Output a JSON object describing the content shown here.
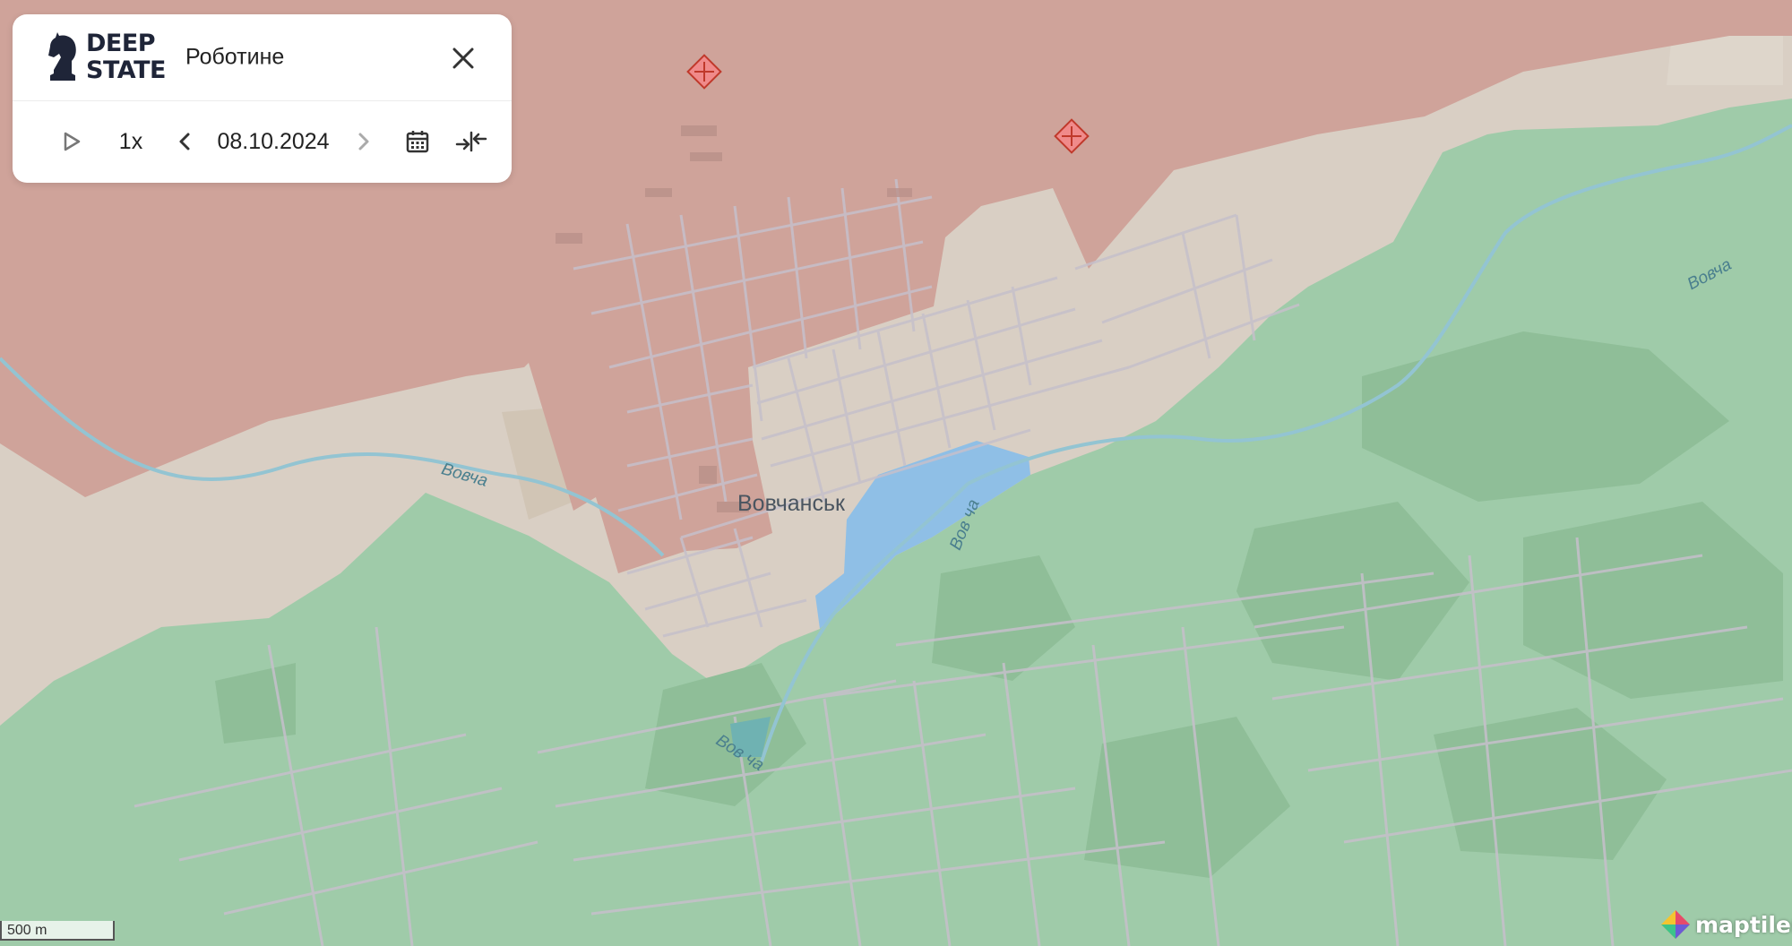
{
  "header": {
    "logo_line1": "DEEP",
    "logo_line2": "STATE",
    "region_name": "Роботине"
  },
  "controls": {
    "speed": "1x",
    "date": "08.10.2024"
  },
  "icons": {
    "logo": "knight-chess-icon",
    "close": "close-icon",
    "play": "play-icon",
    "prev": "chevron-left-icon",
    "next": "chevron-right-icon",
    "calendar": "calendar-icon",
    "collapse": "collapse-arrows-icon",
    "marker": "red-diamond-marker-icon"
  },
  "map": {
    "city_label": "Вовчанськ",
    "river_labels": [
      "Вовча",
      "Вов ча",
      "Вов ча",
      "Вовча"
    ],
    "zone_colors": {
      "occupied": "#cfa39a",
      "grey_zone": "#d9cfc4",
      "controlled": "#9fcba9",
      "contested": "#8fbfe6",
      "street": "#c6c0cb"
    }
  },
  "footer": {
    "scale_label": "500 m",
    "attribution": "maptiler"
  }
}
